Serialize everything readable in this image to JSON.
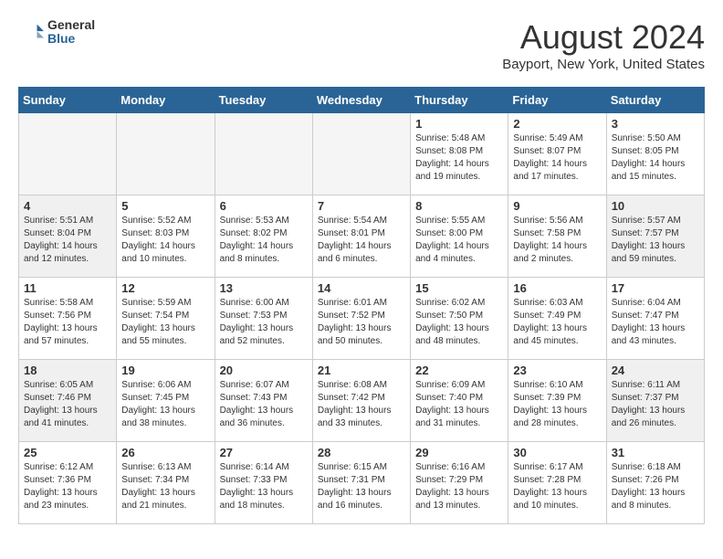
{
  "logo": {
    "general": "General",
    "blue": "Blue"
  },
  "title": "August 2024",
  "location": "Bayport, New York, United States",
  "days_of_week": [
    "Sunday",
    "Monday",
    "Tuesday",
    "Wednesday",
    "Thursday",
    "Friday",
    "Saturday"
  ],
  "weeks": [
    [
      {
        "day": "",
        "empty": true
      },
      {
        "day": "",
        "empty": true
      },
      {
        "day": "",
        "empty": true
      },
      {
        "day": "",
        "empty": true
      },
      {
        "day": "1",
        "sunrise": "5:48 AM",
        "sunset": "8:08 PM",
        "daylight": "14 hours and 19 minutes."
      },
      {
        "day": "2",
        "sunrise": "5:49 AM",
        "sunset": "8:07 PM",
        "daylight": "14 hours and 17 minutes."
      },
      {
        "day": "3",
        "sunrise": "5:50 AM",
        "sunset": "8:05 PM",
        "daylight": "14 hours and 15 minutes."
      }
    ],
    [
      {
        "day": "4",
        "sunrise": "5:51 AM",
        "sunset": "8:04 PM",
        "daylight": "14 hours and 12 minutes."
      },
      {
        "day": "5",
        "sunrise": "5:52 AM",
        "sunset": "8:03 PM",
        "daylight": "14 hours and 10 minutes."
      },
      {
        "day": "6",
        "sunrise": "5:53 AM",
        "sunset": "8:02 PM",
        "daylight": "14 hours and 8 minutes."
      },
      {
        "day": "7",
        "sunrise": "5:54 AM",
        "sunset": "8:01 PM",
        "daylight": "14 hours and 6 minutes."
      },
      {
        "day": "8",
        "sunrise": "5:55 AM",
        "sunset": "8:00 PM",
        "daylight": "14 hours and 4 minutes."
      },
      {
        "day": "9",
        "sunrise": "5:56 AM",
        "sunset": "7:58 PM",
        "daylight": "14 hours and 2 minutes."
      },
      {
        "day": "10",
        "sunrise": "5:57 AM",
        "sunset": "7:57 PM",
        "daylight": "13 hours and 59 minutes."
      }
    ],
    [
      {
        "day": "11",
        "sunrise": "5:58 AM",
        "sunset": "7:56 PM",
        "daylight": "13 hours and 57 minutes."
      },
      {
        "day": "12",
        "sunrise": "5:59 AM",
        "sunset": "7:54 PM",
        "daylight": "13 hours and 55 minutes."
      },
      {
        "day": "13",
        "sunrise": "6:00 AM",
        "sunset": "7:53 PM",
        "daylight": "13 hours and 52 minutes."
      },
      {
        "day": "14",
        "sunrise": "6:01 AM",
        "sunset": "7:52 PM",
        "daylight": "13 hours and 50 minutes."
      },
      {
        "day": "15",
        "sunrise": "6:02 AM",
        "sunset": "7:50 PM",
        "daylight": "13 hours and 48 minutes."
      },
      {
        "day": "16",
        "sunrise": "6:03 AM",
        "sunset": "7:49 PM",
        "daylight": "13 hours and 45 minutes."
      },
      {
        "day": "17",
        "sunrise": "6:04 AM",
        "sunset": "7:47 PM",
        "daylight": "13 hours and 43 minutes."
      }
    ],
    [
      {
        "day": "18",
        "sunrise": "6:05 AM",
        "sunset": "7:46 PM",
        "daylight": "13 hours and 41 minutes."
      },
      {
        "day": "19",
        "sunrise": "6:06 AM",
        "sunset": "7:45 PM",
        "daylight": "13 hours and 38 minutes."
      },
      {
        "day": "20",
        "sunrise": "6:07 AM",
        "sunset": "7:43 PM",
        "daylight": "13 hours and 36 minutes."
      },
      {
        "day": "21",
        "sunrise": "6:08 AM",
        "sunset": "7:42 PM",
        "daylight": "13 hours and 33 minutes."
      },
      {
        "day": "22",
        "sunrise": "6:09 AM",
        "sunset": "7:40 PM",
        "daylight": "13 hours and 31 minutes."
      },
      {
        "day": "23",
        "sunrise": "6:10 AM",
        "sunset": "7:39 PM",
        "daylight": "13 hours and 28 minutes."
      },
      {
        "day": "24",
        "sunrise": "6:11 AM",
        "sunset": "7:37 PM",
        "daylight": "13 hours and 26 minutes."
      }
    ],
    [
      {
        "day": "25",
        "sunrise": "6:12 AM",
        "sunset": "7:36 PM",
        "daylight": "13 hours and 23 minutes."
      },
      {
        "day": "26",
        "sunrise": "6:13 AM",
        "sunset": "7:34 PM",
        "daylight": "13 hours and 21 minutes."
      },
      {
        "day": "27",
        "sunrise": "6:14 AM",
        "sunset": "7:33 PM",
        "daylight": "13 hours and 18 minutes."
      },
      {
        "day": "28",
        "sunrise": "6:15 AM",
        "sunset": "7:31 PM",
        "daylight": "13 hours and 16 minutes."
      },
      {
        "day": "29",
        "sunrise": "6:16 AM",
        "sunset": "7:29 PM",
        "daylight": "13 hours and 13 minutes."
      },
      {
        "day": "30",
        "sunrise": "6:17 AM",
        "sunset": "7:28 PM",
        "daylight": "13 hours and 10 minutes."
      },
      {
        "day": "31",
        "sunrise": "6:18 AM",
        "sunset": "7:26 PM",
        "daylight": "13 hours and 8 minutes."
      }
    ]
  ],
  "labels": {
    "sunrise": "Sunrise:",
    "sunset": "Sunset:",
    "daylight": "Daylight:"
  }
}
